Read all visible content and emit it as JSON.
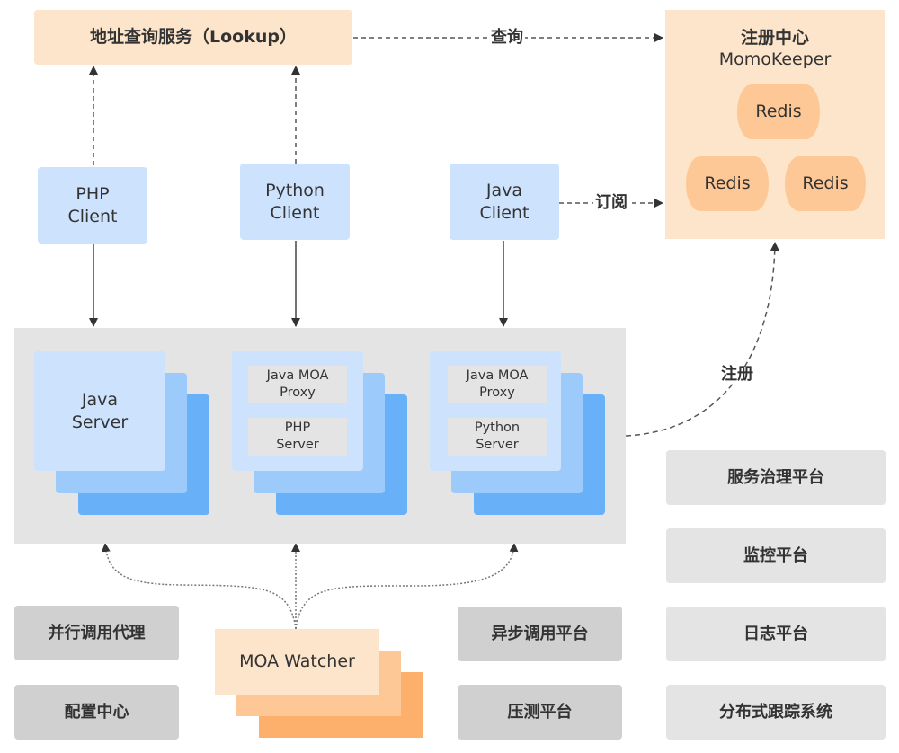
{
  "lookup": {
    "title": "地址查询服务（Lookup）"
  },
  "registry": {
    "title": "注册中心",
    "subtitle": "MomoKeeper",
    "nodes": [
      "Redis",
      "Redis",
      "Redis"
    ]
  },
  "clients": [
    {
      "label": "PHP\nClient"
    },
    {
      "label": "Python\nClient"
    },
    {
      "label": "Java\nClient"
    }
  ],
  "servers": [
    {
      "label": "Java\nServer",
      "inner": []
    },
    {
      "label": "",
      "inner": [
        "Java MOA\nProxy",
        "PHP\nServer"
      ]
    },
    {
      "label": "",
      "inner": [
        "Java MOA\nProxy",
        "Python\nServer"
      ]
    }
  ],
  "edges": {
    "query": "查询",
    "subscribe": "订阅",
    "register": "注册"
  },
  "watcher": {
    "label": "MOA Watcher"
  },
  "left_tools": [
    "并行调用代理",
    "配置中心"
  ],
  "middle_tools": [
    "异步调用平台",
    "压测平台"
  ],
  "right_platforms": [
    "服务治理平台",
    "监控平台",
    "日志平台",
    "分布式跟踪系统"
  ],
  "colors": {
    "orange_light": "#fde5cc",
    "orange_mid": "#fdc896",
    "orange_dark": "#fdb06c",
    "blue_light": "#cde3fd",
    "blue_mid": "#9ccbfb",
    "blue_dark": "#68b1f8",
    "grey_panel": "#e4e4e4",
    "grey_dark": "#d0d0d0",
    "arrow": "#333333"
  }
}
